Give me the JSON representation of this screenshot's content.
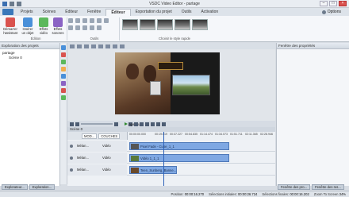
{
  "app": {
    "title": "VSDC Video Editor - partage"
  },
  "tabs": [
    "Projets",
    "Scènes",
    "Éditeur",
    "Fenêtre",
    "Éditeur",
    "Exportation du projet",
    "Outils",
    "Activation"
  ],
  "options_label": "Options",
  "ribbon": {
    "buttons": [
      {
        "label": "Démarrer l'assistant",
        "icon": "wizard-icon"
      },
      {
        "label": "Insérer un objet",
        "icon": "insert-object-icon"
      },
      {
        "label": "Effets vidéo",
        "icon": "video-effects-icon"
      },
      {
        "label": "Effets sonores",
        "icon": "audio-effects-icon"
      }
    ],
    "group_edition": "Édition",
    "group_outils": "Outils",
    "group_style": "Choisir le style rapide"
  },
  "left_panel": {
    "title": "Exploration des projets",
    "project": "partage",
    "scene": "Scène 0"
  },
  "right_panel": {
    "title": "Fenêtre des propriétés"
  },
  "transport": {
    "preview_label": "Aperçu"
  },
  "timeline": {
    "scene_label": "Scène 0",
    "col_modes": "MOD...",
    "col_layers": "COUCHES",
    "ruler": [
      "00:00:00.000",
      "00:19.619",
      "00:37.227",
      "00:54.835",
      "01:14.474",
      "01:34.073",
      "01:51.711",
      "02:11.365",
      "02:28.946"
    ],
    "tracks": [
      {
        "name": "Mélan...",
        "type": "Vidéo",
        "clip": "Pixel Fade - Cube_1_1"
      },
      {
        "name": "Mélan...",
        "type": "Vidéo",
        "clip": "Vidéo 1_1_1"
      },
      {
        "name": "Mélan...",
        "type": "Vidéo",
        "clip": "Teen_Sunberg_Banne..."
      }
    ]
  },
  "bottom_tabs": {
    "left": [
      "Explorateur...",
      "Exploration..."
    ],
    "right": [
      "Fenêtre des pro...",
      "Fenêtre des res..."
    ]
  },
  "status": {
    "position_label": "Position:",
    "position_value": "00:00:16.270",
    "selection_start_label": "Sélections initiales:",
    "selection_start_value": "00:00:26.724",
    "selection_end_label": "Sélections finales:",
    "selection_end_value": "00:00:16.202",
    "zoom_label": "Zoom To Screen",
    "zoom_value": "34%"
  }
}
